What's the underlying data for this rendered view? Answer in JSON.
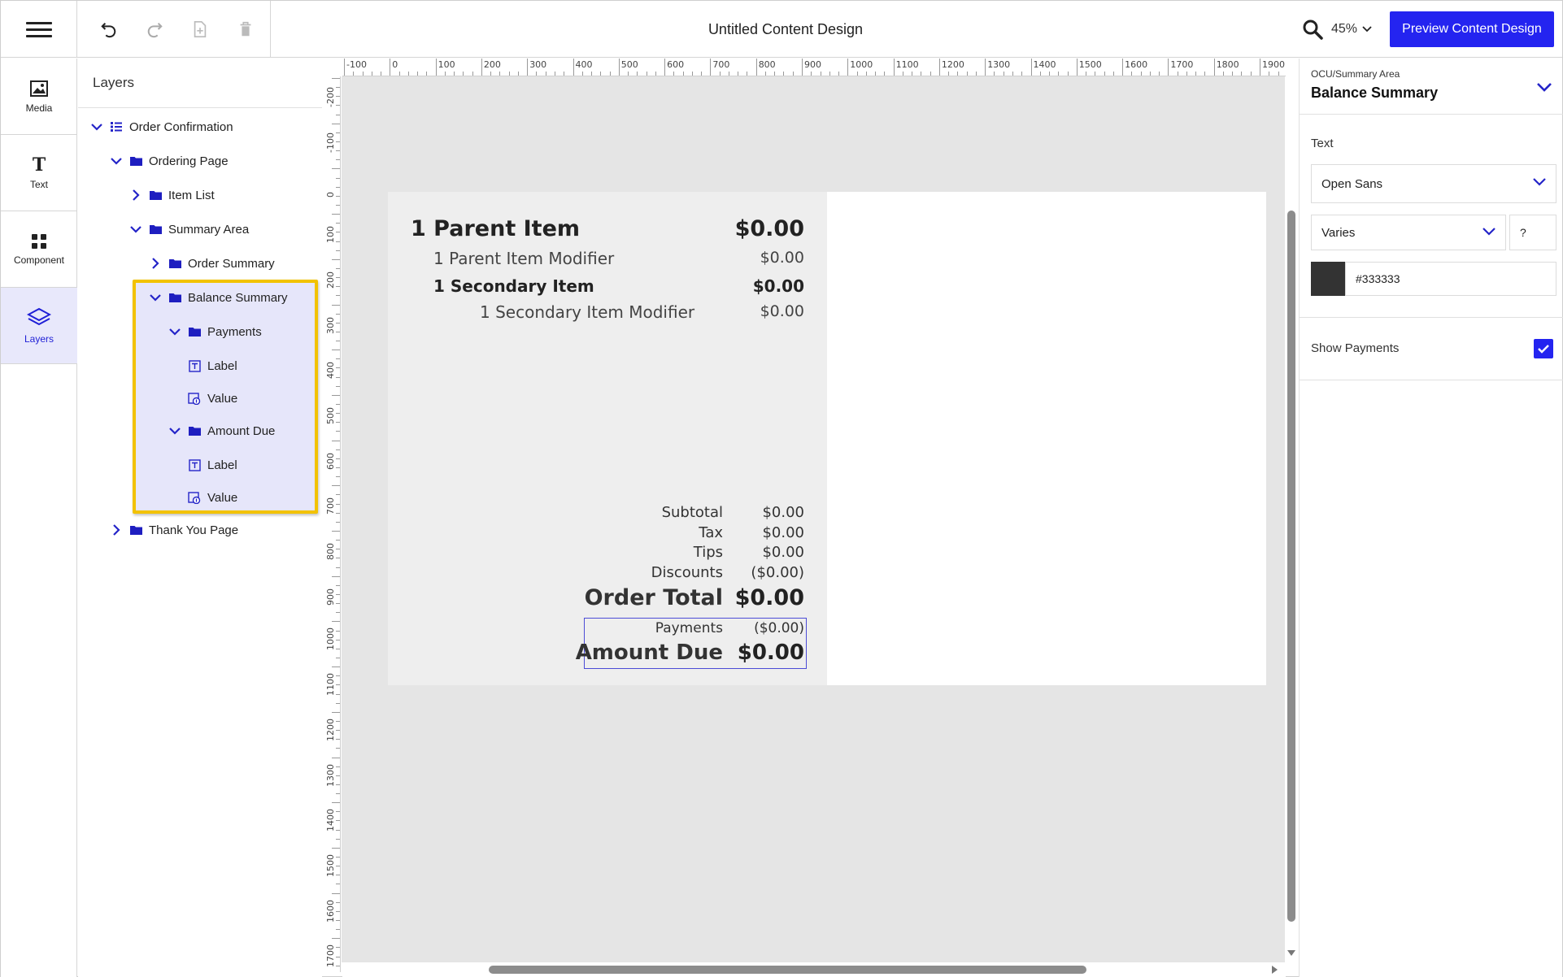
{
  "header": {
    "doc_title": "Untitled Content Design",
    "zoom": "45%",
    "preview_label": "Preview Content Design",
    "tools": [
      "undo-icon",
      "redo-icon",
      "add-page-icon",
      "delete-icon"
    ]
  },
  "rail": {
    "items": [
      {
        "label": "Media",
        "icon": "image-icon"
      },
      {
        "label": "Text",
        "icon": "text-icon"
      },
      {
        "label": "Component",
        "icon": "grid-icon"
      },
      {
        "label": "Layers",
        "icon": "layers-icon",
        "active": true
      }
    ]
  },
  "layers": {
    "title": "Layers",
    "tree": [
      {
        "label": "Order Confirmation",
        "expanded": true,
        "icon": "list-icon"
      },
      {
        "label": "Ordering Page",
        "expanded": true,
        "icon": "folder-icon"
      },
      {
        "label": "Item List",
        "expanded": false,
        "icon": "folder-icon"
      },
      {
        "label": "Summary Area",
        "expanded": true,
        "icon": "folder-icon"
      },
      {
        "label": "Order Summary",
        "expanded": false,
        "icon": "folder-icon"
      },
      {
        "label": "Balance Summary",
        "expanded": true,
        "icon": "folder-icon",
        "selected": true
      },
      {
        "label": "Payments",
        "expanded": true,
        "icon": "folder-icon"
      },
      {
        "label": "Label",
        "icon": "text-field-icon"
      },
      {
        "label": "Value",
        "icon": "dynamic-value-icon"
      },
      {
        "label": "Amount Due",
        "expanded": true,
        "icon": "folder-icon"
      },
      {
        "label": "Label",
        "icon": "text-field-icon"
      },
      {
        "label": "Value",
        "icon": "dynamic-value-icon"
      },
      {
        "label": "Thank You Page",
        "expanded": false,
        "icon": "folder-icon"
      }
    ]
  },
  "ruler": {
    "top": [
      "-100",
      "0",
      "100",
      "200",
      "300",
      "400",
      "500",
      "600",
      "700",
      "800",
      "900",
      "1000",
      "1100",
      "1200",
      "1300",
      "1400",
      "1500",
      "1600",
      "1700",
      "1800",
      "1900"
    ],
    "left": [
      "-200",
      "-100",
      "0",
      "100",
      "200",
      "300",
      "400",
      "500",
      "600",
      "700",
      "800",
      "900",
      "1000",
      "1100",
      "1200",
      "1300",
      "1400",
      "1500",
      "1600",
      "1700"
    ]
  },
  "receipt": {
    "parent_item": "1 Parent Item",
    "parent_price": "$0.00",
    "parent_modifier": "1 Parent Item Modifier",
    "parent_modifier_price": "$0.00",
    "secondary_item": "1 Secondary Item",
    "secondary_price": "$0.00",
    "secondary_modifier": "1 Secondary Item Modifier",
    "secondary_modifier_price": "$0.00",
    "subtotal_label": "Subtotal",
    "subtotal_value": "$0.00",
    "tax_label": "Tax",
    "tax_value": "$0.00",
    "tips_label": "Tips",
    "tips_value": "$0.00",
    "discounts_label": "Discounts",
    "discounts_value": "($0.00)",
    "order_total_label": "Order Total",
    "order_total_value": "$0.00",
    "payments_label": "Payments",
    "payments_value": "($0.00)",
    "amount_due_label": "Amount Due",
    "amount_due_value": "$0.00"
  },
  "properties": {
    "breadcrumb": "OCU/Summary Area",
    "selected_name": "Balance Summary",
    "text_label": "Text",
    "font_family": "Open Sans",
    "font_weight": "Varies",
    "font_size": "?",
    "color_hex": "#333333",
    "show_payments_label": "Show Payments",
    "show_payments": true
  },
  "colors": {
    "accent": "#2424f0",
    "highlight_border": "#f2c200",
    "selection_bg": "#e6e6fa",
    "text_swatch": "#333333"
  }
}
